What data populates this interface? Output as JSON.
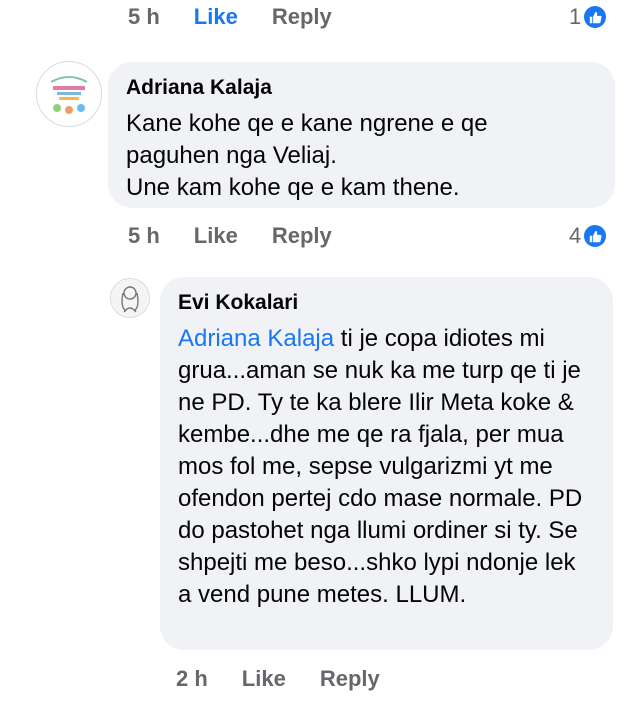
{
  "comment_top": {
    "time": "5 h",
    "like": "Like",
    "reply": "Reply",
    "reactions": "1"
  },
  "comment1": {
    "author": "Adriana Kalaja",
    "text": "Kane kohe qe e kane ngrene e qe\npaguhen  nga Veliaj.\nUne kam kohe qe e kam thene.",
    "time": "5 h",
    "like": "Like",
    "reply": "Reply",
    "reactions": "4"
  },
  "comment2": {
    "author": "Evi Kokalari",
    "mention": "Adriana Kalaja",
    "text": " ti je copa idiotes mi grua...aman se nuk ka me turp qe ti je ne PD. Ty te ka blere Ilir Meta koke & kembe...dhe me qe ra fjala, per mua mos fol me, sepse vulgarizmi yt me ofendon pertej cdo mase normale. PD do pastohet nga llumi ordiner si ty. Se shpejti me beso...shko lypi ndonje lek a vend pune metes. LLUM.",
    "time": "2 h",
    "like": "Like",
    "reply": "Reply"
  },
  "colors": {
    "accent": "#1877f2",
    "bubble": "#f0f2f5",
    "meta": "#65676b"
  }
}
